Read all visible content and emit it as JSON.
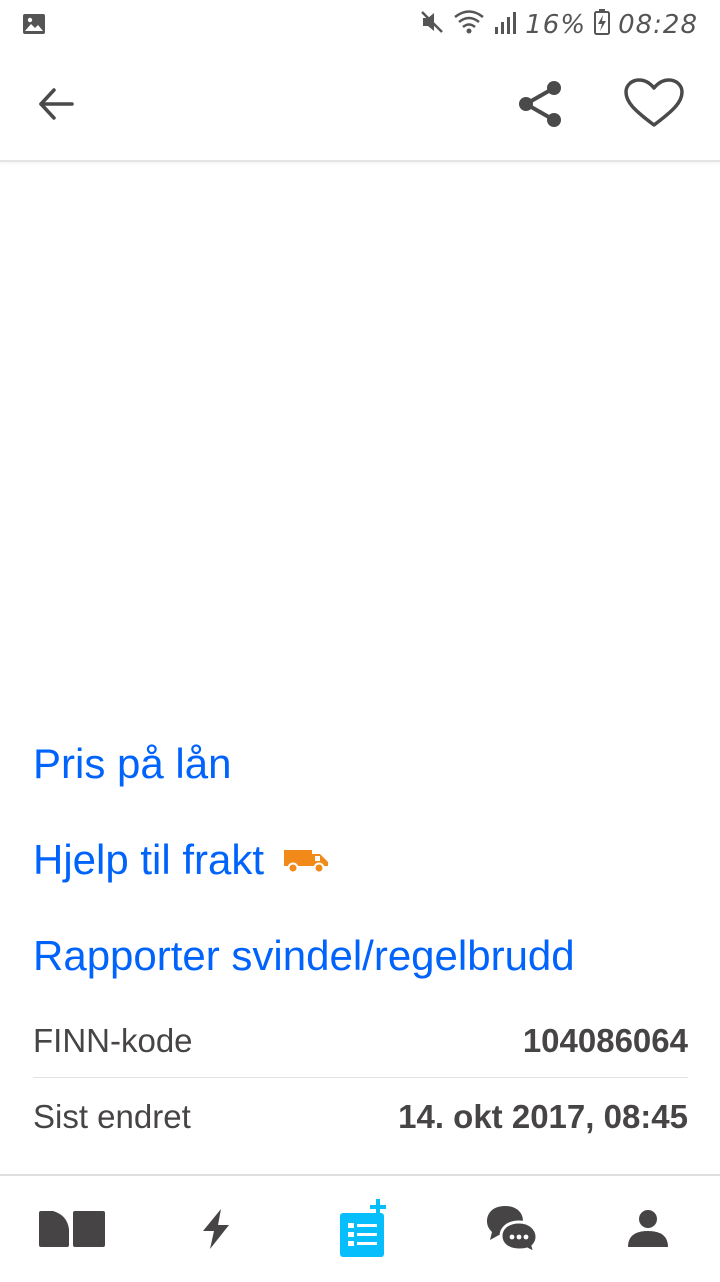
{
  "status_bar": {
    "battery_percent": "16%",
    "time": "08:28",
    "icons": [
      "image-icon",
      "mute-icon",
      "wifi-icon",
      "signal-icon",
      "battery-icon"
    ]
  },
  "app_bar": {
    "icons": [
      "back-arrow-icon",
      "share-icon",
      "heart-icon"
    ]
  },
  "links": {
    "loan": "Pris på lån",
    "shipping": "Hjelp til frakt",
    "report": "Rapporter svindel/regelbrudd"
  },
  "info": {
    "finn_code_label": "FINN-kode",
    "finn_code_value": "104086064",
    "last_changed_label": "Sist endret",
    "last_changed_value": "14. okt 2017, 08:45"
  },
  "bottom_nav": {
    "items": [
      "market-icon",
      "bolt-icon",
      "new-ad-icon",
      "messages-icon",
      "profile-icon"
    ],
    "active_color": "#06befb",
    "inactive_color": "#474445"
  },
  "colors": {
    "link": "#0063fb",
    "text": "#474445",
    "van": "#f28a1a"
  }
}
